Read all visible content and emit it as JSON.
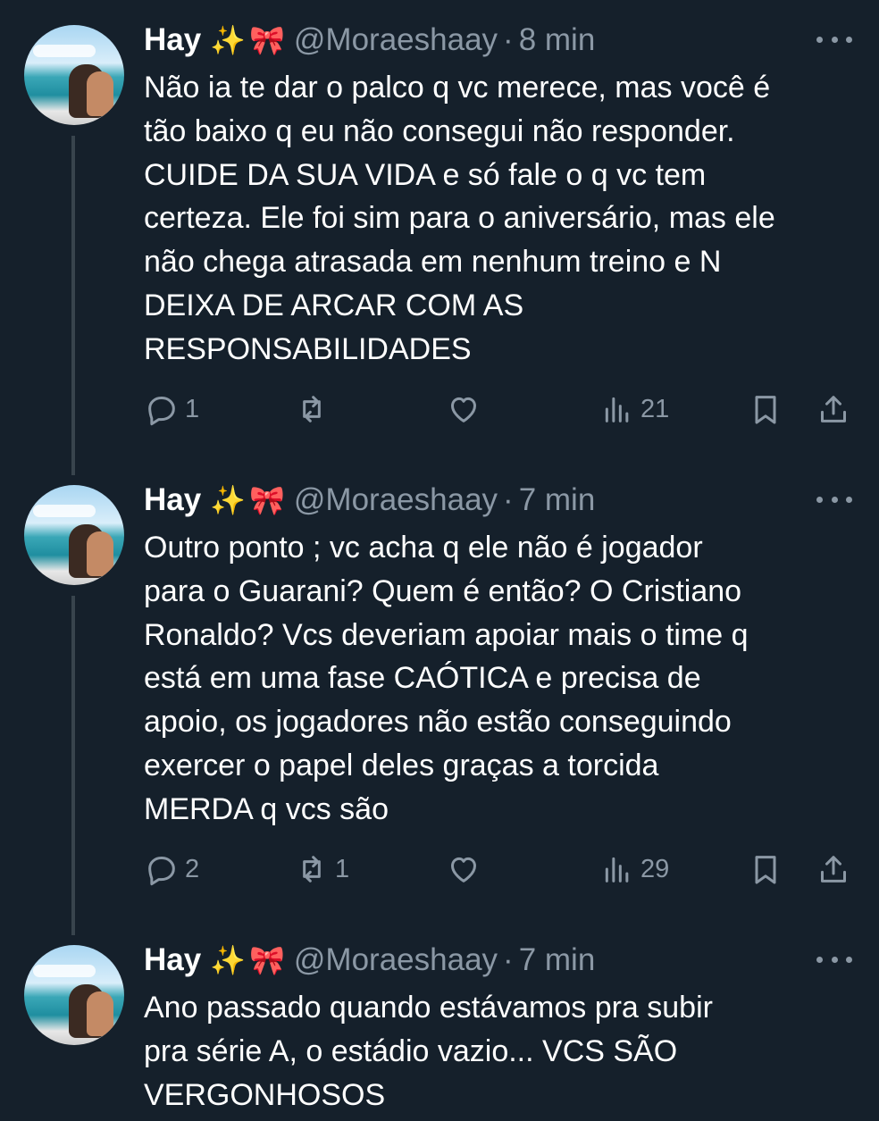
{
  "tweets": [
    {
      "name": "Hay",
      "emoji1": "✨",
      "emoji2": "🎀",
      "handle": "@Moraeshaay",
      "separator": "·",
      "time": "8 min",
      "text": "Não ia te dar o palco q vc merece, mas você é\ntão baixo q eu não consegui não responder.\nCUIDE DA SUA VIDA e só fale o q vc tem\ncerteza. Ele foi sim para o aniversário, mas ele\nnão chega atrasada em nenhum treino e N\nDEIXA DE ARCAR COM AS\nRESPONSABILIDADES",
      "replies": "1",
      "retweets": "",
      "likes": "",
      "views": "21"
    },
    {
      "name": "Hay",
      "emoji1": "✨",
      "emoji2": "🎀",
      "handle": "@Moraeshaay",
      "separator": "·",
      "time": "7 min",
      "text": "Outro ponto ; vc acha q ele não é jogador\npara o Guarani? Quem é então? O Cristiano\nRonaldo? Vcs deveriam apoiar mais o time q\nestá em uma fase CAÓTICA e precisa de\napoio, os jogadores não estão conseguindo\nexercer o papel deles graças a torcida\nMERDA q vcs são",
      "replies": "2",
      "retweets": "1",
      "likes": "",
      "views": "29"
    },
    {
      "name": "Hay",
      "emoji1": "✨",
      "emoji2": "🎀",
      "handle": "@Moraeshaay",
      "separator": "·",
      "time": "7 min",
      "text": "Ano passado quando estávamos pra subir\npra série A, o estádio vazio... VCS SÃO\nVERGONHOSOS"
    }
  ],
  "icons": {
    "reply": "reply-icon",
    "retweet": "retweet-icon",
    "like": "heart-icon",
    "views": "views-icon",
    "bookmark": "bookmark-icon",
    "share": "share-icon",
    "more": "more-icon"
  },
  "colors": {
    "background": "#15202b",
    "secondary_text": "#8b98a5",
    "thread_line": "#38444d"
  }
}
